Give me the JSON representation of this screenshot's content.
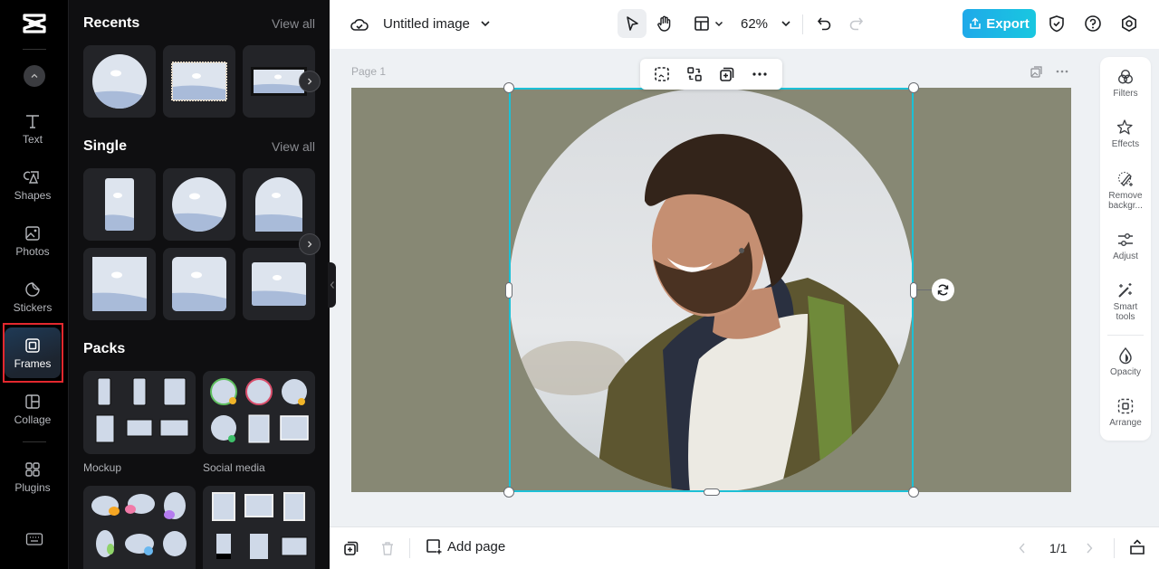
{
  "rail": {
    "items": [
      {
        "label": "Text",
        "icon": "text-icon"
      },
      {
        "label": "Shapes",
        "icon": "shapes-icon"
      },
      {
        "label": "Photos",
        "icon": "photos-icon"
      },
      {
        "label": "Stickers",
        "icon": "stickers-icon"
      },
      {
        "label": "Frames",
        "icon": "frames-icon",
        "active": true
      },
      {
        "label": "Collage",
        "icon": "collage-icon"
      },
      {
        "label": "Plugins",
        "icon": "plugins-icon"
      }
    ]
  },
  "panel": {
    "recents": {
      "title": "Recents",
      "view_all": "View all"
    },
    "single": {
      "title": "Single",
      "view_all": "View all"
    },
    "packs": {
      "title": "Packs",
      "items": [
        {
          "label": "Mockup"
        },
        {
          "label": "Social media"
        }
      ]
    }
  },
  "topbar": {
    "title": "Untitled image",
    "zoom": "62%",
    "export_label": "Export",
    "export_color": "#1fb4e6"
  },
  "canvas": {
    "page_label": "Page 1",
    "background_color": "#878874",
    "selection_color": "#1cc0d6"
  },
  "right_tools": [
    {
      "label": "Filters",
      "icon": "filters-icon"
    },
    {
      "label": "Effects",
      "icon": "effects-icon"
    },
    {
      "label": "Remove backgr...",
      "icon": "remove-background-icon"
    },
    {
      "label": "Adjust",
      "icon": "adjust-icon"
    },
    {
      "label": "Smart tools",
      "icon": "smart-tools-icon"
    },
    {
      "label": "Opacity",
      "icon": "opacity-icon"
    },
    {
      "label": "Arrange",
      "icon": "arrange-icon"
    }
  ],
  "bottombar": {
    "add_page": "Add page",
    "page_count": "1/1"
  }
}
